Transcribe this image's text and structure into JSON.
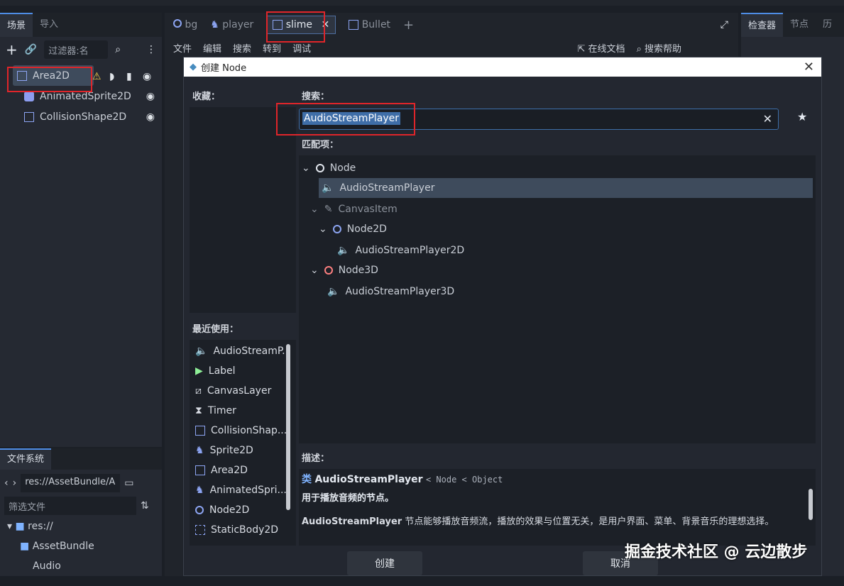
{
  "left_dock": {
    "tabs": [
      "场景",
      "导入"
    ],
    "filter_placeholder": "过滤器:名",
    "tree": [
      {
        "label": "Area2D",
        "selected": true
      },
      {
        "label": "AnimatedSprite2D"
      },
      {
        "label": "CollisionShape2D"
      }
    ]
  },
  "file_system": {
    "title": "文件系统",
    "path": "res://AssetBundle/A",
    "filter_placeholder": "筛选文件",
    "items": [
      "res://",
      "AssetBundle",
      "Audio"
    ]
  },
  "editor_tabs": [
    {
      "label": "bg"
    },
    {
      "label": "player"
    },
    {
      "label": "slime",
      "active": true
    },
    {
      "label": "Bullet"
    }
  ],
  "script_menu": [
    "文件",
    "编辑",
    "搜索",
    "转到",
    "调试"
  ],
  "script_toolbar": {
    "online_docs": "在线文档",
    "search_help": "搜索帮助"
  },
  "right_dock": {
    "tabs": [
      "检查器",
      "节点",
      "历"
    ]
  },
  "dialog": {
    "title": "创建 Node",
    "favorites_label": "收藏：",
    "recent_label": "最近使用：",
    "search_label": "搜索：",
    "search_value": "AudioStreamPlayer",
    "matches_label": "匹配项：",
    "matches": [
      {
        "label": "Node",
        "depth": 0
      },
      {
        "label": "AudioStreamPlayer",
        "depth": 1,
        "selected": true
      },
      {
        "label": "CanvasItem",
        "depth": 1,
        "dim": true
      },
      {
        "label": "Node2D",
        "depth": 2
      },
      {
        "label": "AudioStreamPlayer2D",
        "depth": 3
      },
      {
        "label": "Node3D",
        "depth": 1
      },
      {
        "label": "AudioStreamPlayer3D",
        "depth": 2
      }
    ],
    "recent": [
      "AudioStreamP...",
      "Label",
      "CanvasLayer",
      "Timer",
      "CollisionShap...",
      "Sprite2D",
      "Area2D",
      "AnimatedSpri...",
      "Node2D",
      "StaticBody2D"
    ],
    "description_label": "描述：",
    "desc_kind": "类",
    "desc_class": "AudioStreamPlayer",
    "desc_inherits": "< Node < Object",
    "desc_brief": "用于播放音频的节点。",
    "desc_long_name": "AudioStreamPlayer",
    "desc_long_text": " 节点能够播放音频流，播放的效果与位置无关，是用户界面、菜单、背景音乐的理想选择。",
    "create_button": "创建",
    "cancel_button": "取消"
  },
  "watermark": "掘金技术社区 @ 云边散步"
}
